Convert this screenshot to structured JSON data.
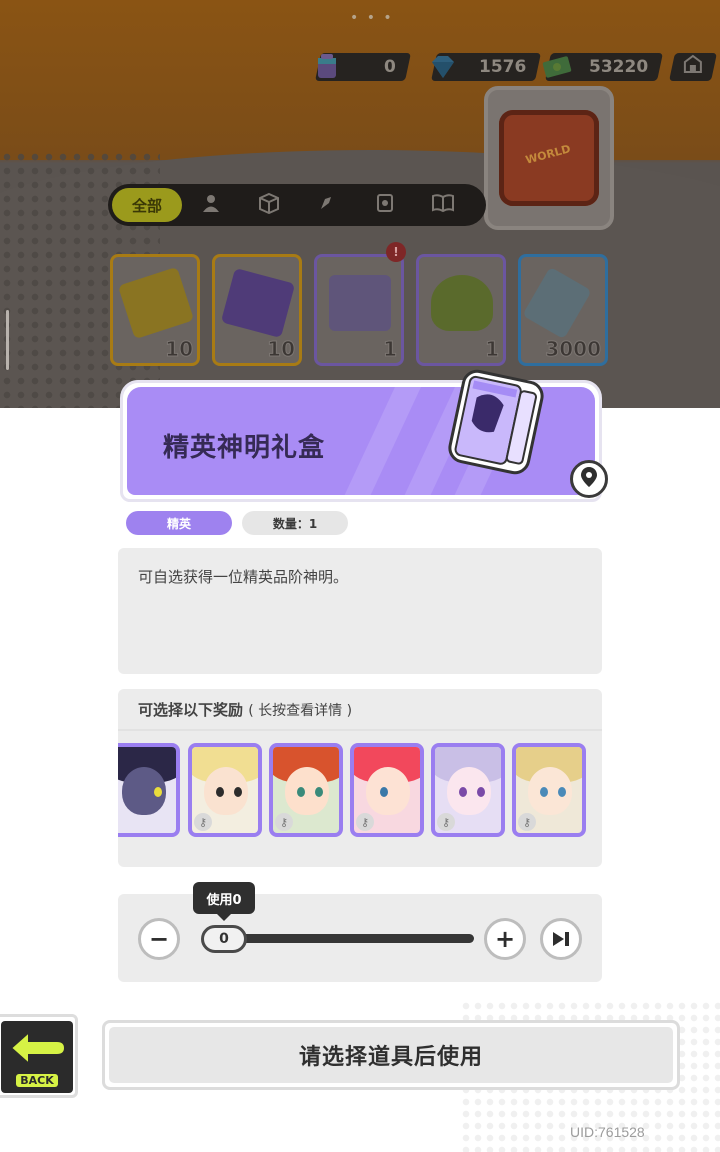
{
  "currencies": [
    {
      "icon": "paint-can-icon",
      "value": "0"
    },
    {
      "icon": "diamond-icon",
      "value": "1576"
    },
    {
      "icon": "cash-icon",
      "value": "53220"
    }
  ],
  "filter_tabs": {
    "active_label": "全部",
    "icons": [
      "person-icon",
      "box-icon",
      "pen-icon",
      "card-icon",
      "book-icon"
    ]
  },
  "inventory": [
    {
      "icon": "ticket-gold-icon",
      "count": "10",
      "border": "#a87b14"
    },
    {
      "icon": "ticket-purple-icon",
      "count": "10",
      "border": "#a87b14"
    },
    {
      "icon": "gift-box-icon",
      "count": "1",
      "border": "#6b56a0"
    },
    {
      "icon": "cup-icon",
      "count": "1",
      "border": "#6b56a0"
    },
    {
      "icon": "paint-tube-icon",
      "count": "3000",
      "border": "#2f6e9e"
    }
  ],
  "inventory_badge": "!",
  "item": {
    "name": "精英神明礼盒",
    "rarity": "精英",
    "quantity": "数量：1",
    "description": "可自选获得一位精英品阶神明。"
  },
  "rewards": {
    "title": "可选择以下奖励",
    "hint": "( 长按查看详情 )"
  },
  "use": {
    "tooltip": "使用0",
    "value": "0",
    "minus": "−",
    "plus": "+"
  },
  "buttons": {
    "back_label": "BACK",
    "main_label": "请选择道具后使用"
  },
  "uid": "UID:761528",
  "colors": {
    "accent_purple": "#a98cf5",
    "rarity_purple": "#9e82ef"
  }
}
